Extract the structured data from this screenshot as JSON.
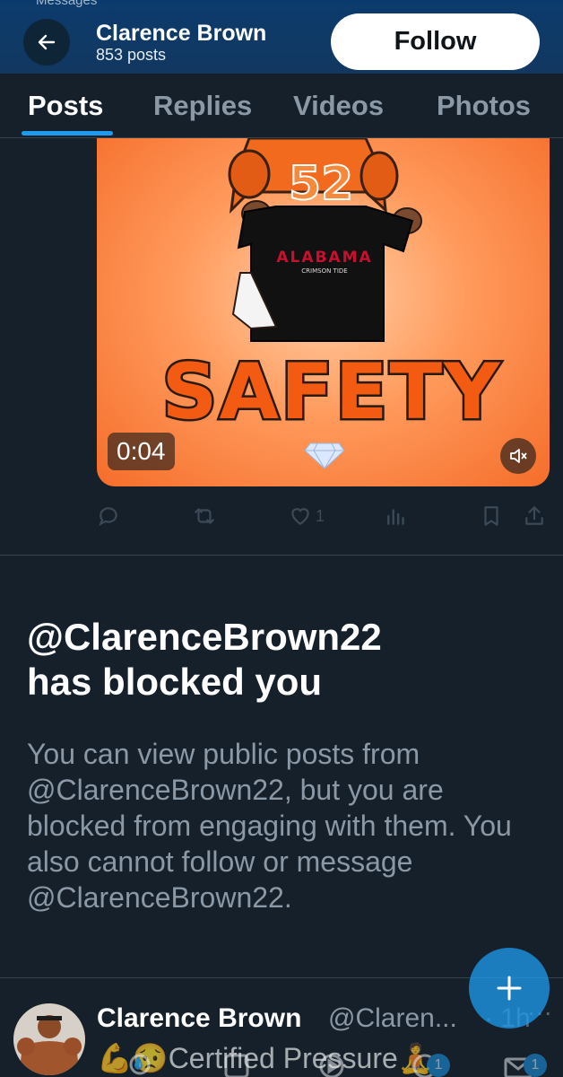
{
  "header": {
    "top_cut_text": "Messages",
    "profile_name": "Clarence Brown",
    "post_count": "853 posts",
    "follow_label": "Follow"
  },
  "tabs": [
    {
      "label": "Posts",
      "active": true
    },
    {
      "label": "Replies",
      "active": false
    },
    {
      "label": "Videos",
      "active": false
    },
    {
      "label": "Photos",
      "active": false
    }
  ],
  "media": {
    "jersey_number": "52",
    "shirt_text": "ALABAMA",
    "shirt_subtext": "CRIMSON TIDE",
    "overlay_word": "SAFETY",
    "duration": "0:04",
    "colors": {
      "background": "#f56d2a",
      "text_fill": "#f35b12",
      "text_outline": "#2a1a14"
    }
  },
  "actions": {
    "like_count": "1",
    "icons": [
      "reply-icon",
      "retweet-icon",
      "like-icon",
      "views-icon",
      "bookmark-icon",
      "share-icon"
    ]
  },
  "blocked": {
    "title_line1": "@ClarenceBrown22",
    "title_line2": "has blocked you",
    "body": "You can view public posts from @ClarenceBrown22, but you are blocked from engaging with them. You also cannot follow or message @ClarenceBrown22."
  },
  "next_post": {
    "name": "Clarence Brown",
    "handle": "@Claren...",
    "time": "· 1h",
    "more": "···",
    "text": "💪😥Certified Pressure🧘"
  },
  "bottom_nav": {
    "badges": [
      "1",
      "1"
    ]
  },
  "theme": {
    "background": "#15202b",
    "accent": "#1d9bf0",
    "muted_text": "#8b98a5",
    "divider": "#38444d"
  }
}
